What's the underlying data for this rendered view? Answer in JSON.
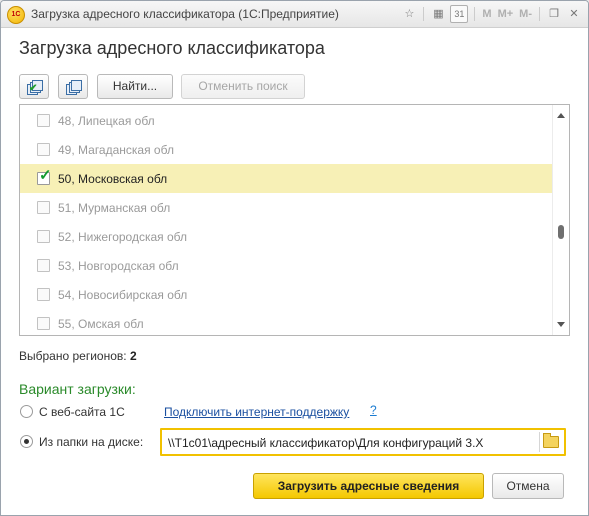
{
  "window": {
    "title": "Загрузка адресного классификатора  (1С:Предприятие)",
    "logo_text": "1С",
    "toolbar_icons": [
      "star-icon",
      "calculator-icon",
      "calendar-icon",
      "m-label",
      "m-plus-label",
      "m-minus-label",
      "restore-icon",
      "close-icon"
    ],
    "m": "M",
    "m_plus": "M+",
    "m_minus": "M-",
    "calendar_day": "31"
  },
  "form": {
    "title": "Загрузка адресного классификатора"
  },
  "toolbar": {
    "find_label": "Найти...",
    "cancel_search_label": "Отменить поиск"
  },
  "regions": [
    {
      "label": "48, Липецкая обл",
      "checked": false
    },
    {
      "label": "49, Магаданская обл",
      "checked": false
    },
    {
      "label": "50, Московская обл",
      "checked": true
    },
    {
      "label": "51, Мурманская обл",
      "checked": false
    },
    {
      "label": "52, Нижегородская обл",
      "checked": false
    },
    {
      "label": "53, Новгородская обл",
      "checked": false
    },
    {
      "label": "54, Новосибирская обл",
      "checked": false
    },
    {
      "label": "55, Омская обл",
      "checked": false
    }
  ],
  "summary": {
    "selected_label": "Выбрано регионов:",
    "selected_count": "2"
  },
  "load_variant": {
    "title": "Вариант загрузки:",
    "from_site_label": "С веб-сайта 1С",
    "connect_link": "Подключить интернет-поддержку",
    "help_link": "?",
    "from_folder_label": "Из папки на диске:",
    "folder_path": "\\\\T1c01\\адресный классификатор\\Для конфигураций 3.X",
    "selected_option": "folder"
  },
  "actions": {
    "load_label": "Загрузить адресные сведения",
    "cancel_label": "Отмена"
  },
  "colors": {
    "accent_yellow": "#f4c800",
    "selected_row": "#f7f0b6",
    "section_green": "#2a8a2a",
    "link_blue": "#1a4fa0"
  }
}
